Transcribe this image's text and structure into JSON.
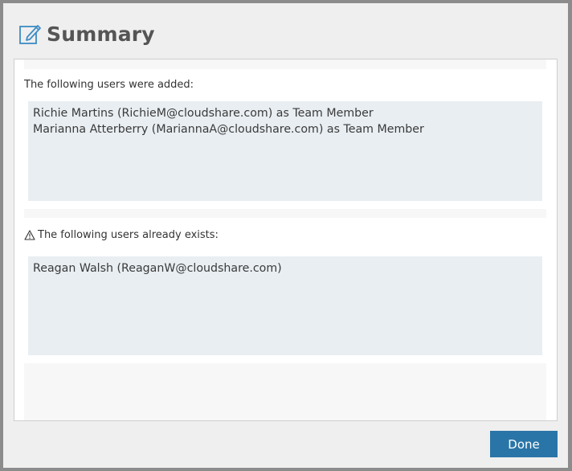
{
  "dialog": {
    "title": "Summary",
    "icon": "edit-icon"
  },
  "added": {
    "label": "The following users were added:",
    "users": [
      "Richie Martins (RichieM@cloudshare.com) as Team Member",
      "Marianna Atterberry (MariannaA@cloudshare.com) as Team Member"
    ]
  },
  "existing": {
    "label": "The following users already exists:",
    "icon": "warning-icon",
    "users": [
      "Reagan Walsh (ReaganW@cloudshare.com)"
    ]
  },
  "footer": {
    "done_label": "Done",
    "done_color": "#2a75a8"
  }
}
